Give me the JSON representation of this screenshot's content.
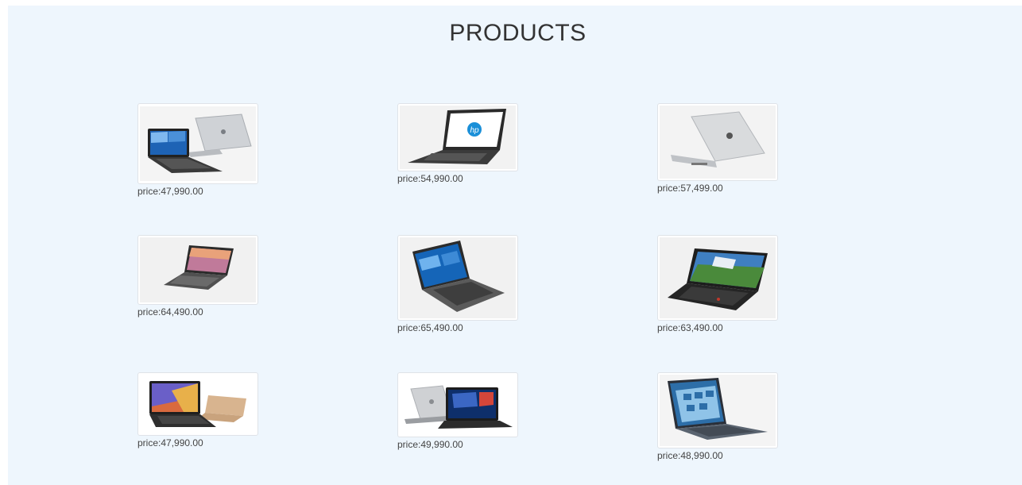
{
  "page": {
    "title": "PRODUCTS"
  },
  "products": [
    {
      "price_text": "price:47,990.00",
      "image": "laptop-image"
    },
    {
      "price_text": "price:54,990.00",
      "image": "laptop-image"
    },
    {
      "price_text": "price:57,499.00",
      "image": "laptop-image"
    },
    {
      "price_text": "price:64,490.00",
      "image": "laptop-image"
    },
    {
      "price_text": "price:65,490.00",
      "image": "laptop-image"
    },
    {
      "price_text": "price:63,490.00",
      "image": "laptop-image"
    },
    {
      "price_text": "price:47,990.00",
      "image": "laptop-image"
    },
    {
      "price_text": "price:49,990.00",
      "image": "laptop-image"
    },
    {
      "price_text": "price:48,990.00",
      "image": "laptop-image"
    }
  ],
  "colors": {
    "background": "#eef6fd",
    "title": "#333333",
    "price_text": "#444444"
  }
}
